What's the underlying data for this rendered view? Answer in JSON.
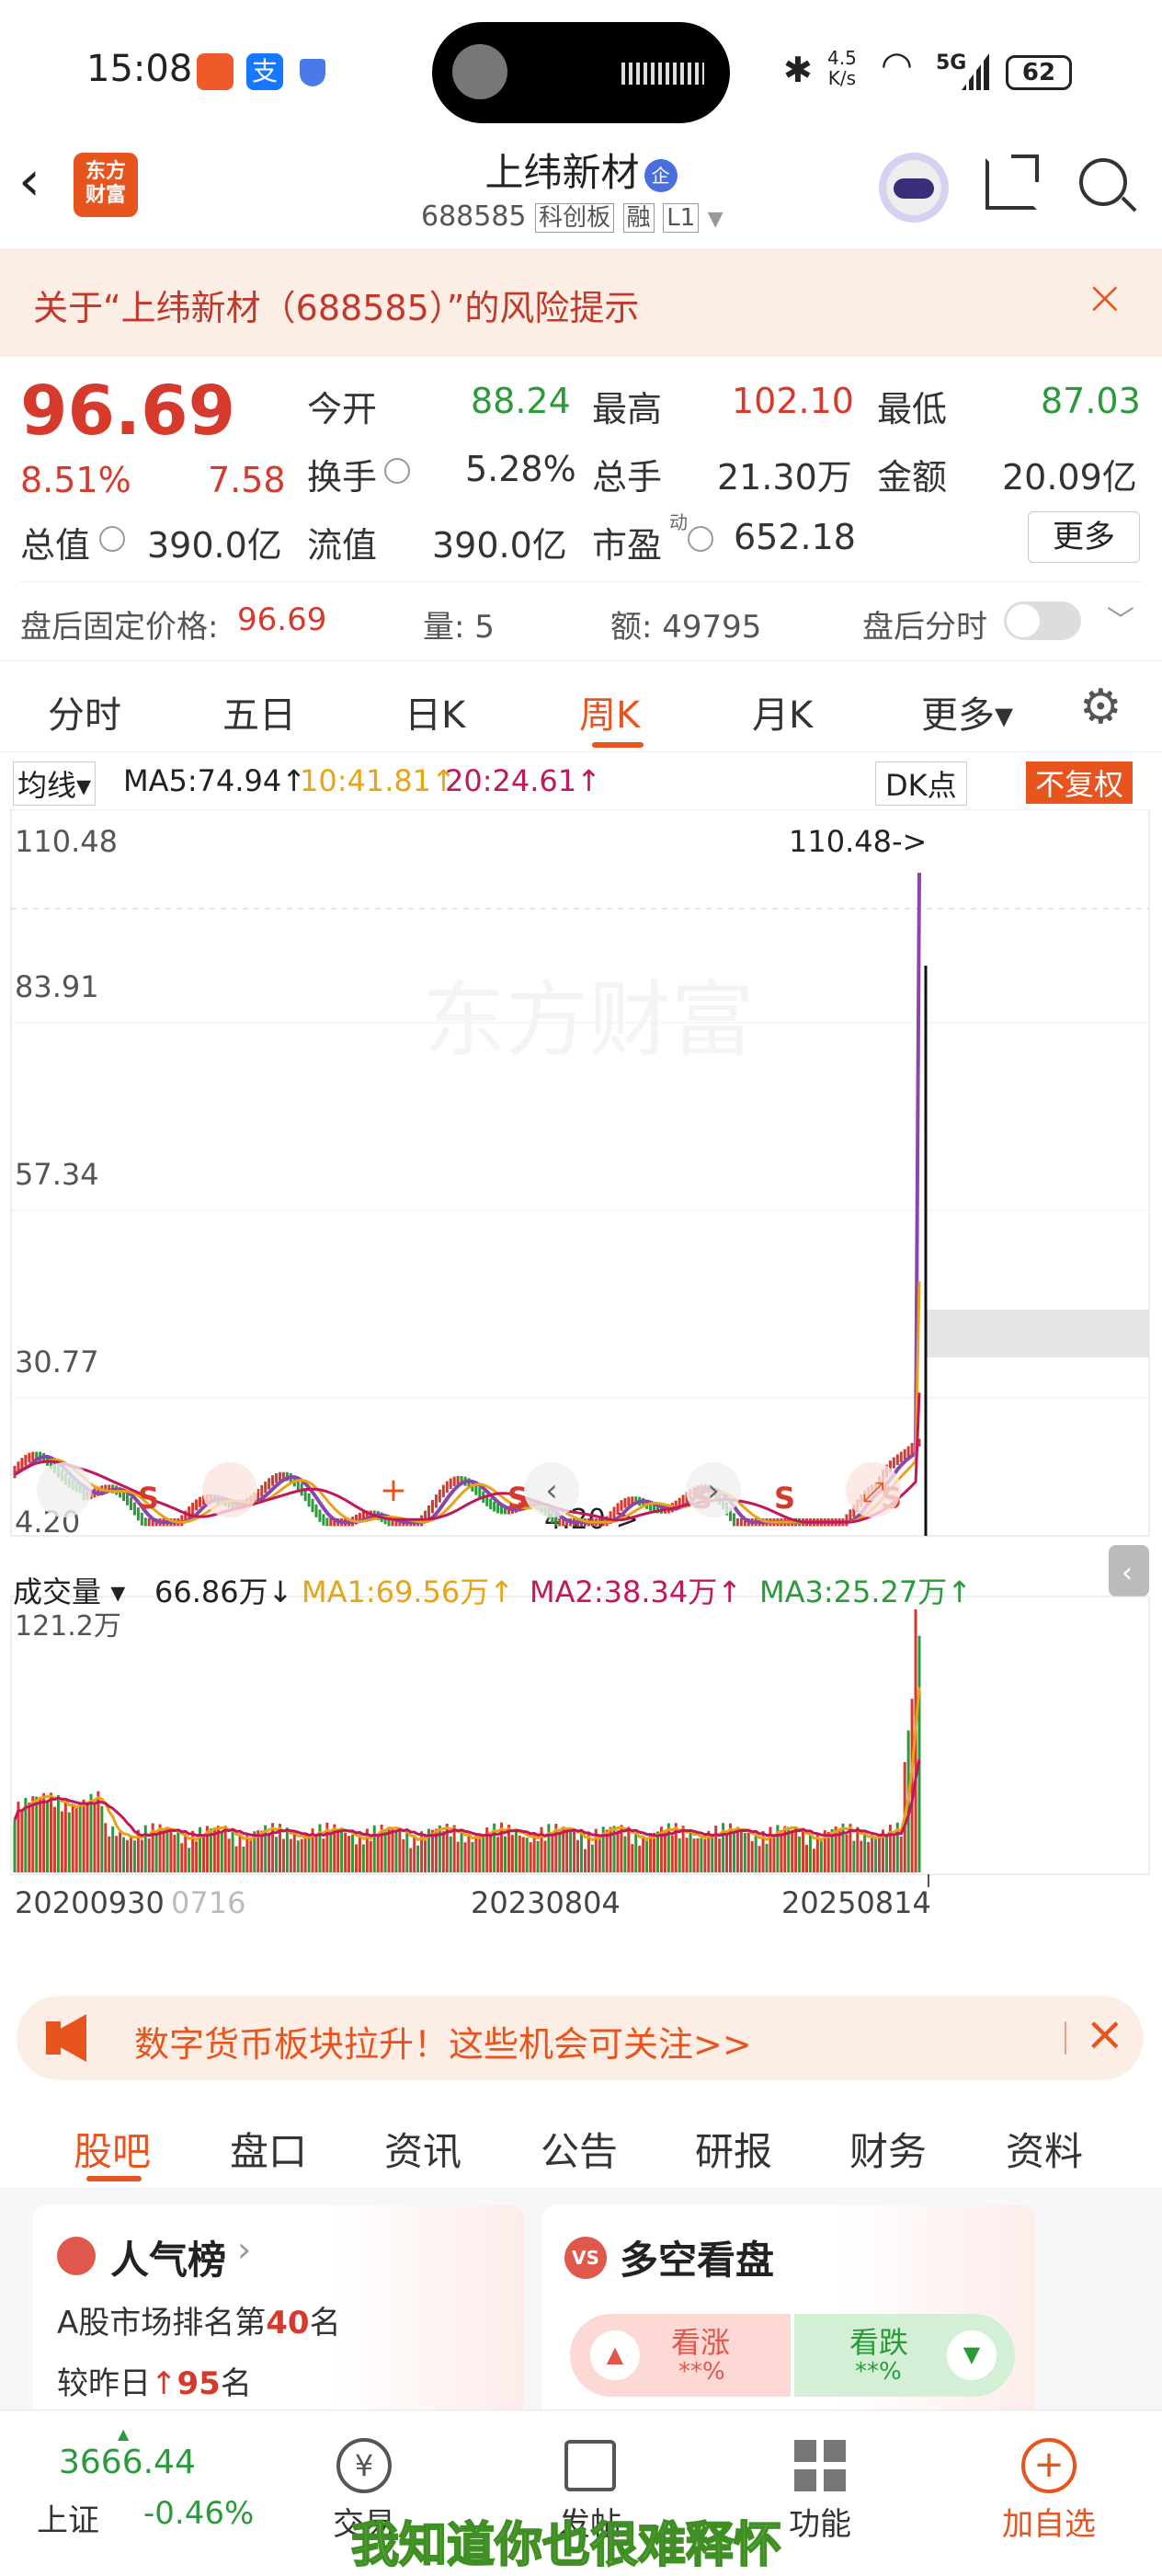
{
  "status_bar": {
    "time": "15:08",
    "net_speed_top": "4.5",
    "net_speed_bottom": "K/s",
    "network": "5G",
    "battery": "62"
  },
  "header": {
    "logo_line1": "东方",
    "logo_line2": "财富",
    "title": "上纬新材",
    "badge": "企",
    "code": "688585",
    "board": "科创板",
    "margin": "融",
    "level": "L1"
  },
  "risk_banner": {
    "text": "关于“上纬新材（688585）”的风险提示"
  },
  "quote": {
    "price": "96.69",
    "change_pct": "8.51%",
    "change": "7.58",
    "row1": [
      {
        "label": "今开",
        "value": "88.24",
        "color": "#2b9a3a"
      },
      {
        "label": "最高",
        "value": "102.10",
        "color": "#d63a2c"
      },
      {
        "label": "最低",
        "value": "87.03",
        "color": "#2b9a3a"
      }
    ],
    "row2": [
      {
        "label": "换手",
        "value": "5.28%"
      },
      {
        "label": "总手",
        "value": "21.30万"
      },
      {
        "label": "金额",
        "value": "20.09亿"
      }
    ],
    "row3": [
      {
        "label": "总值",
        "value": "390.0亿"
      },
      {
        "label": "流值",
        "value": "390.0亿"
      },
      {
        "label": "市盈",
        "value": "652.18",
        "sup": "动"
      }
    ],
    "more_button": "更多",
    "after_hours": {
      "price_label": "盘后固定价格:",
      "price": "96.69",
      "vol_label": "量: 5",
      "amt_label": "额: 49795",
      "toggle_label": "盘后分时"
    }
  },
  "tabs": [
    {
      "label": "分时"
    },
    {
      "label": "五日"
    },
    {
      "label": "日K"
    },
    {
      "label": "周K",
      "active": true
    },
    {
      "label": "月K"
    },
    {
      "label": "更多▾"
    }
  ],
  "ma_legend": {
    "selector": "均线",
    "ma5": "MA5:74.94↑",
    "ma10": "10:41.81↑",
    "ma20": "20:24.61↑",
    "dk": "DK点",
    "adj": "不复权"
  },
  "price_chart": {
    "y_ticks": [
      "110.48",
      "83.91",
      "57.34",
      "30.77",
      "4.20"
    ],
    "max_label": "110.48->",
    "min_label": "4.20->",
    "watermark": "东方财富",
    "signal": "S"
  },
  "volume": {
    "selector": "成交量",
    "vol": "66.86万↓",
    "ma1": "MA1:69.56万↑",
    "ma2": "MA2:38.34万↑",
    "ma3": "MA3:25.27万↑",
    "max_label": "121.2万"
  },
  "x_labels": [
    "20200930",
    "0716",
    "20230804",
    "20250814"
  ],
  "chart_data": {
    "type": "candlestick",
    "title": "上纬新材 周K",
    "ylim": [
      4.2,
      110.48
    ],
    "y_ticks": [
      110.48,
      83.91,
      57.34,
      30.77,
      4.2
    ],
    "x_ticks": [
      "20200930",
      "20230804",
      "20250814"
    ],
    "last_close": 96.69,
    "ma": {
      "MA5": 74.94,
      "MA10": 41.81,
      "MA20": 24.61
    },
    "volume_max": "121.2万",
    "series_colors": {
      "MA5": "#8e44ad",
      "MA10": "#e8a317",
      "MA20": "#c2185b"
    }
  },
  "ad_banner": {
    "text": "数字货币板块拉升！这些机会可关注>>"
  },
  "sub_tabs": [
    {
      "label": "股吧",
      "active": true
    },
    {
      "label": "盘口"
    },
    {
      "label": "资讯"
    },
    {
      "label": "公告"
    },
    {
      "label": "研报"
    },
    {
      "label": "财务"
    },
    {
      "label": "资料"
    }
  ],
  "popularity_card": {
    "title": "人气榜",
    "rank_prefix": "A股市场排名第",
    "rank": "40",
    "rank_suffix": "名",
    "change_prefix": "较昨日",
    "change": "95",
    "change_suffix": "名"
  },
  "sentiment_card": {
    "title": "多空看盘",
    "badge": "VS",
    "bull": "看涨",
    "bull_pct": "**%",
    "bear": "看跌",
    "bear_pct": "**%"
  },
  "bottom_nav": {
    "index_value": "3666.44",
    "index_name": "上证",
    "index_change": "-0.46%",
    "trade": "交易",
    "post": "发帖",
    "functions": "功能",
    "add": "加自选"
  },
  "subtitle_overlay": "我知道你也很难释怀",
  "colors": {
    "up": "#d63a2c",
    "down": "#2b9a3a",
    "accent": "#e8541e"
  }
}
